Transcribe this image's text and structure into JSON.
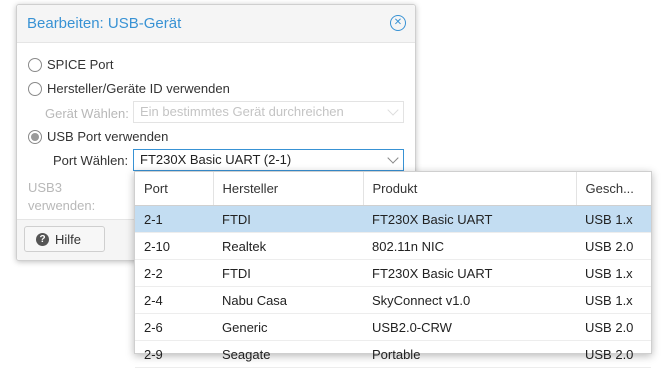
{
  "dialog": {
    "title": "Bearbeiten: USB-Gerät",
    "options": [
      {
        "label": "SPICE Port",
        "checked": false
      },
      {
        "label": "Hersteller/Geräte ID verwenden",
        "checked": false
      },
      {
        "label": "USB Port verwenden",
        "checked": true
      }
    ],
    "device_select": {
      "label": "Gerät Wählen:",
      "placeholder": "Ein bestimmtes Gerät durchreichen"
    },
    "port_select": {
      "label": "Port Wählen:",
      "value": "FT230X Basic UART (2-1)"
    },
    "usb3": {
      "line1": "USB3",
      "line2": "verwenden:"
    },
    "help_label": "Hilfe"
  },
  "dropdown": {
    "columns": [
      "Port",
      "Hersteller",
      "Produkt",
      "Gesch..."
    ],
    "selected_index": 0,
    "rows": [
      [
        "2-1",
        "FTDI",
        "FT230X Basic UART",
        "USB 1.x"
      ],
      [
        "2-10",
        "Realtek",
        "802.11n NIC",
        "USB 2.0"
      ],
      [
        "2-2",
        "FTDI",
        "FT230X Basic UART",
        "USB 1.x"
      ],
      [
        "2-4",
        "Nabu Casa",
        "SkyConnect v1.0",
        "USB 1.x"
      ],
      [
        "2-6",
        "Generic",
        "USB2.0-CRW",
        "USB 2.0"
      ],
      [
        "2-9",
        "Seagate",
        "Portable",
        "USB 2.0"
      ]
    ]
  },
  "colors": {
    "accent": "#3892d4",
    "selected_row": "#c3ddf2"
  },
  "icons": {
    "close": "close-circle-icon",
    "help": "question-icon",
    "dropdown": "chevron-down-icon"
  }
}
